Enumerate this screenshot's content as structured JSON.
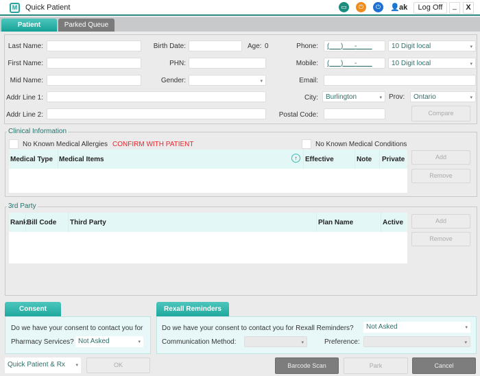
{
  "window": {
    "title": "Quick Patient",
    "user": "ak",
    "logoff": "Log Off",
    "minimize": "_",
    "close": "X"
  },
  "tabs": [
    {
      "label": "Patient",
      "active": true
    },
    {
      "label": "Parked Queue",
      "active": false
    }
  ],
  "form": {
    "last_name": {
      "label": "Last Name:",
      "value": ""
    },
    "first_name": {
      "label": "First Name:",
      "value": ""
    },
    "mid_name": {
      "label": "Mid Name:",
      "value": ""
    },
    "addr1": {
      "label": "Addr Line 1:",
      "value": ""
    },
    "addr2": {
      "label": "Addr Line 2:",
      "value": ""
    },
    "birth_date": {
      "label": "Birth Date:",
      "value": ""
    },
    "age": {
      "label": "Age:",
      "value": "0"
    },
    "phn": {
      "label": "PHN:",
      "value": ""
    },
    "gender": {
      "label": "Gender:",
      "value": ""
    },
    "phone": {
      "label": "Phone:",
      "value": "(___)___-____",
      "type": "10 Digit local"
    },
    "mobile": {
      "label": "Mobile:",
      "value": "(___)___-____",
      "type": "10 Digit local"
    },
    "email": {
      "label": "Email:",
      "value": ""
    },
    "city": {
      "label": "City:",
      "value": "Burlington"
    },
    "prov": {
      "label": "Prov:",
      "value": "Ontario"
    },
    "postal": {
      "label": "Postal Code:",
      "value": ""
    },
    "compare": "Compare"
  },
  "clinical": {
    "legend": "Clinical Information",
    "allergies": "No Known Medical Allergies",
    "confirm": "CONFIRM WITH PATIENT",
    "conditions": "No Known Medical Conditions",
    "columns": [
      "Medical Type",
      "Medical Items",
      "Effective",
      "Note",
      "Private"
    ],
    "add": "Add",
    "remove": "Remove"
  },
  "third_party": {
    "legend": "3rd Party",
    "columns": [
      "Rank",
      "Bill Code",
      "Third Party",
      "Plan Name",
      "Active"
    ],
    "add": "Add",
    "remove": "Remove"
  },
  "consent": {
    "tab": "Consent",
    "question": "Do we have your consent to contact you for",
    "label": "Pharmacy Services?",
    "value": "Not Asked"
  },
  "reminders": {
    "tab": "Rexall Reminders",
    "question": "Do we have your consent to contact you for Rexall Reminders?",
    "value": "Not Asked",
    "method_label": "Communication Method:",
    "method": "",
    "pref_label": "Preference:",
    "pref": ""
  },
  "footer": {
    "mode": "Quick Patient & Rx",
    "ok": "OK",
    "barcode": "Barcode Scan",
    "park": "Park",
    "cancel": "Cancel"
  },
  "colors": {
    "accent": "#1fa89e",
    "warning": "#e8232a"
  }
}
